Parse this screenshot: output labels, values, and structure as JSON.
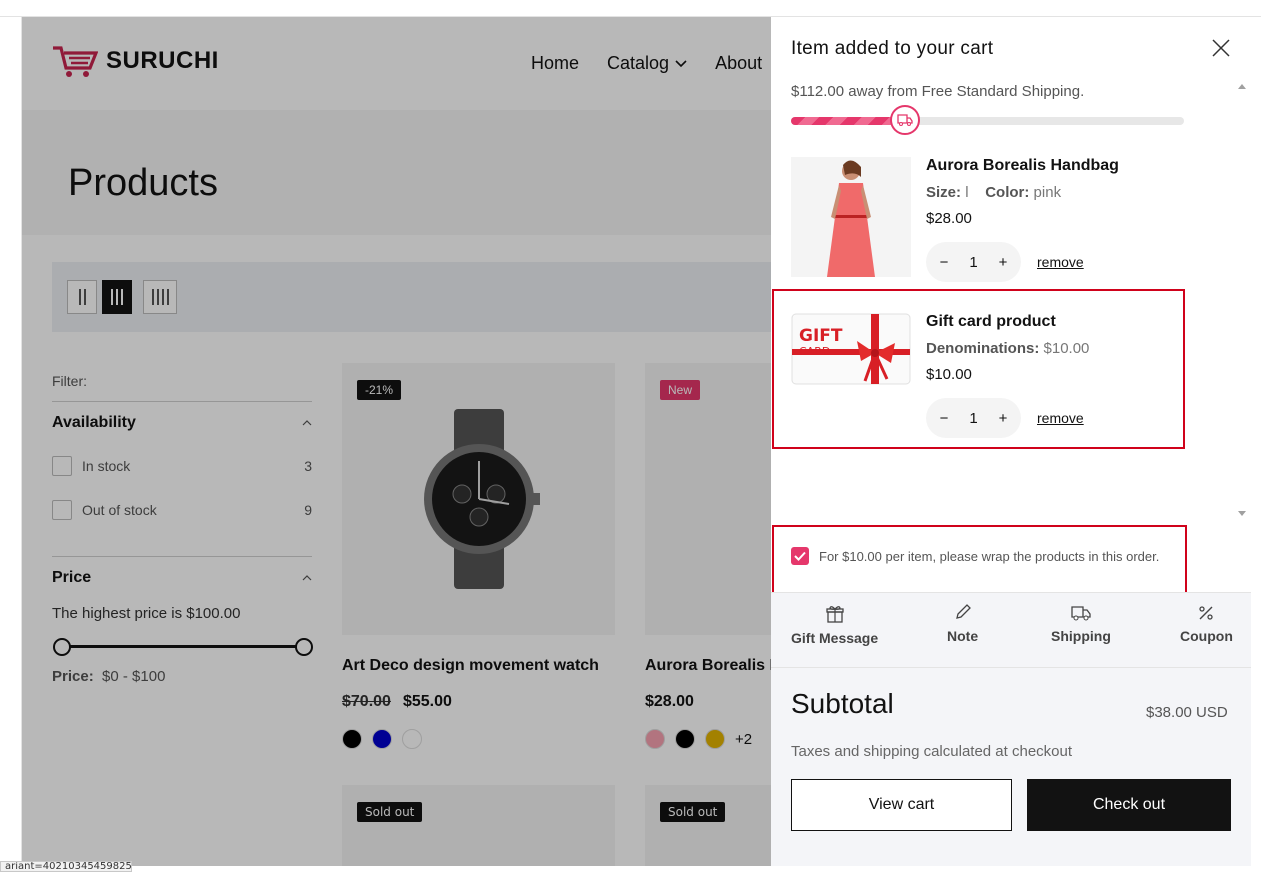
{
  "site": {
    "logo_text": "SURUCHI",
    "nav": [
      "Home",
      "Catalog",
      "About"
    ]
  },
  "page": {
    "title": "Products",
    "filter_label": "Filter:",
    "availability": {
      "heading": "Availability",
      "options": [
        {
          "label": "In stock",
          "count": "3"
        },
        {
          "label": "Out of stock",
          "count": "9"
        }
      ]
    },
    "price": {
      "heading": "Price",
      "note": "The highest price is $100.00",
      "range_label": "Price:",
      "range_value": "$0 - $100"
    },
    "products": [
      {
        "badge": "-21%",
        "badge_color": "#121212",
        "name": "Art Deco design movement watch",
        "old_price": "$70.00",
        "price": "$55.00",
        "swatches": [
          "#000000",
          "#0000cc",
          "#ffffff"
        ],
        "more": ""
      },
      {
        "badge": "New",
        "badge_color": "#e5376b",
        "name": "Aurora Borealis H",
        "old_price": "",
        "price": "$28.00",
        "swatches": [
          "#f7a1b0",
          "#000000",
          "#e2b300"
        ],
        "more": "+2"
      }
    ],
    "row2_badges": [
      "Sold out",
      "Sold out"
    ]
  },
  "cart": {
    "title": "Item added to your cart",
    "shipping_text": "$112.00 away from Free Standard Shipping.",
    "shipping_progress": 0.29,
    "items": [
      {
        "title": "Aurora Borealis Handbag",
        "meta1_label": "Size:",
        "meta1_value": "l",
        "meta2_label": "Color:",
        "meta2_value": "pink",
        "price": "$28.00",
        "qty": "1",
        "remove": "remove"
      },
      {
        "title": "Gift card product",
        "meta1_label": "Denominations:",
        "meta1_value": "$10.00",
        "price": "$10.00",
        "qty": "1",
        "remove": "remove",
        "thumb_text_1": "GIFT",
        "thumb_text_2": "CARD"
      }
    ],
    "wrap_text": "For $10.00 per item, please wrap the products in this order.",
    "actions": [
      {
        "label": "Gift Message",
        "icon": "gift-icon"
      },
      {
        "label": "Note",
        "icon": "pencil-icon"
      },
      {
        "label": "Shipping",
        "icon": "truck-icon"
      },
      {
        "label": "Coupon",
        "icon": "percent-icon"
      }
    ],
    "subtotal_label": "Subtotal",
    "subtotal_value": "$38.00 USD",
    "tax_note": "Taxes and shipping calculated at checkout",
    "view_cart": "View cart",
    "checkout": "Check out"
  },
  "status_url": "ariant=40210345459825",
  "colors": {
    "accent": "#e5376b",
    "highlight": "#d0021b",
    "dark": "#121212"
  }
}
